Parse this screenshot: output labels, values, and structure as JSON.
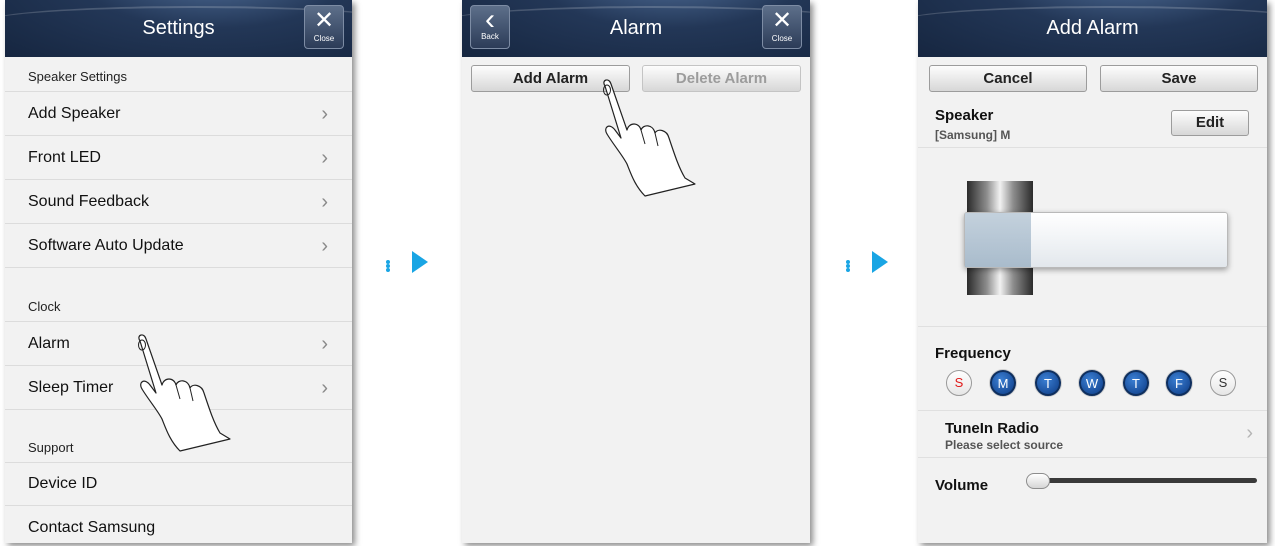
{
  "settings": {
    "title": "Settings",
    "close_label": "Close",
    "close_glyph": "✕",
    "sections": [
      {
        "header": "Speaker Settings"
      },
      {
        "header": "Clock"
      },
      {
        "header": "Support"
      }
    ],
    "items": {
      "add_speaker": "Add Speaker",
      "front_led": "Front LED",
      "sound_feedback": "Sound Feedback",
      "software_auto_update": "Software Auto Update",
      "alarm": "Alarm",
      "sleep_timer": "Sleep Timer",
      "device_id": "Device ID",
      "contact_samsung": "Contact Samsung"
    },
    "chevron": "›"
  },
  "alarm": {
    "title": "Alarm",
    "back_label": "Back",
    "back_glyph": "‹",
    "close_label": "Close",
    "close_glyph": "✕",
    "add_alarm": "Add Alarm",
    "delete_alarm": "Delete Alarm"
  },
  "add_alarm": {
    "title": "Add Alarm",
    "cancel": "Cancel",
    "save": "Save",
    "speaker_label": "Speaker",
    "speaker_value": "[Samsung] M",
    "edit": "Edit",
    "frequency_label": "Frequency",
    "days": [
      "S",
      "M",
      "T",
      "W",
      "T",
      "F",
      "S"
    ],
    "days_selected": [
      false,
      true,
      true,
      true,
      true,
      true,
      false
    ],
    "source_title": "TuneIn Radio",
    "source_sub": "Please select source",
    "chevron": "›",
    "volume_label": "Volume",
    "volume_level": 0.0
  },
  "colors": {
    "accent_arrow": "#19a5e4",
    "header_navy": "#1c2e4c",
    "day_selected": "#1a4f9c",
    "sunday_text": "#e01919"
  },
  "icons": [
    "close-icon",
    "back-icon",
    "chevron-right-icon",
    "flow-arrow-icon",
    "pointing-hand-icon"
  ]
}
